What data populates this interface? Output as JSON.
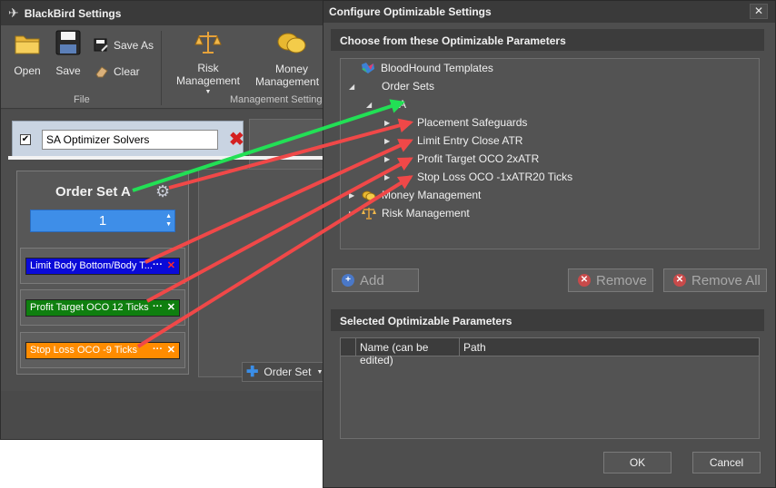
{
  "bb_window": {
    "title": "BlackBird Settings",
    "ribbon": {
      "open_label": "Open",
      "save_label": "Save",
      "save_as_label": "Save  As",
      "clear_label": "Clear",
      "file_group": "File",
      "risk_label": "Risk Management",
      "money_label_1": "Money",
      "money_label_2": "Management",
      "mgmt_group": "Management Settings"
    },
    "solver_name": "SA Optimizer Solvers",
    "order_set_title": "Order Set A",
    "quantity": "1",
    "add_order_set_label": "Order Set",
    "orders": [
      {
        "label": "Limit  Body Bottom/Body T...",
        "color": "#0a0ad8",
        "x_color": "#ff2a2a"
      },
      {
        "label": "Profit Target OCO  12 Ticks",
        "color": "#0f7f0f",
        "x_color": "#ffffff"
      },
      {
        "label": "Stop Loss OCO  -9 Ticks",
        "color": "#ff8c00",
        "x_color": "#ffffff"
      }
    ]
  },
  "dialog": {
    "title": "Configure Optimizable Settings",
    "close_glyph": "✕",
    "choose_header": "Choose from these Optimizable Parameters",
    "tree": {
      "bloodhound": "BloodHound Templates",
      "order_sets": "Order Sets",
      "a": "A",
      "placement": "Placement Safeguards",
      "limit_entry": "Limit Entry Close ATR",
      "profit_target": "Profit Target OCO  2xATR",
      "stop_loss": "Stop Loss OCO  -1xATR20 Ticks",
      "money": "Money Management",
      "risk": "Risk Management"
    },
    "add_label": "Add",
    "remove_label": "Remove",
    "remove_all_label": "Remove All",
    "selected_header": "Selected Optimizable Parameters",
    "grid_columns": [
      "Name (can be edited)",
      "Path"
    ],
    "ok_label": "OK",
    "cancel_label": "Cancel"
  },
  "colors": {
    "green_arrow": "#22e055",
    "red_arrow": "#f04848"
  }
}
